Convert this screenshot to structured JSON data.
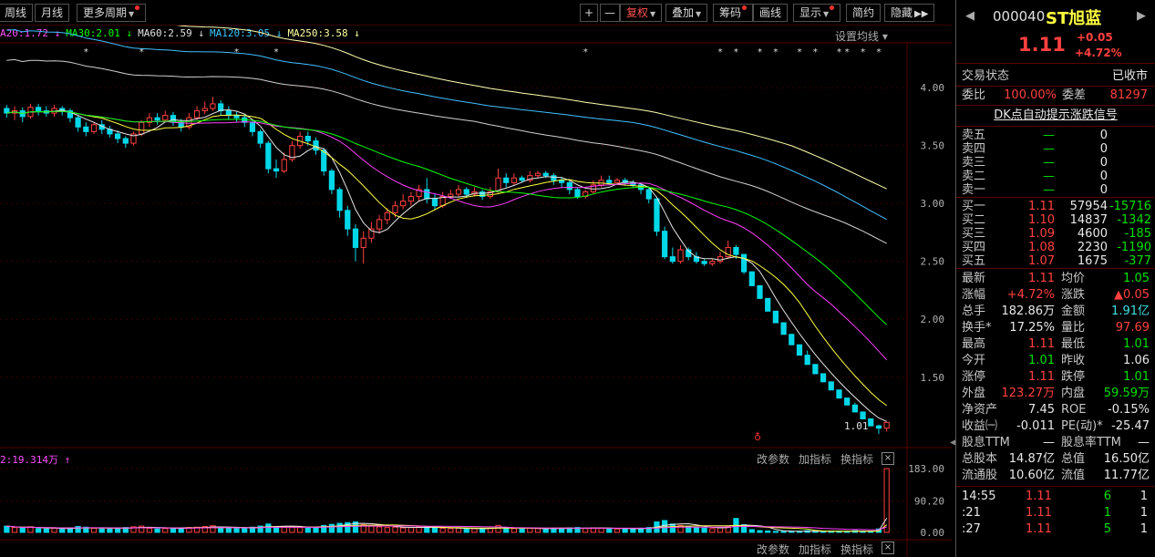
{
  "toolbar": {
    "weekly": "周线",
    "monthly": "月线",
    "more_periods": "更多周期",
    "plus": "+",
    "minus": "—",
    "adjust": "复权",
    "overlay": "叠加",
    "chips": "筹码",
    "draw": "画线",
    "display": "显示",
    "simple": "简约",
    "hide": "隐藏"
  },
  "ma_legend": [
    {
      "text": "A20:1.72",
      "color": "#ff50ff",
      "arrow": "↓"
    },
    {
      "text": "MA30:2.01",
      "color": "#00ff00",
      "arrow": "↓"
    },
    {
      "text": "MA60:2.59",
      "color": "#e0e0e0",
      "arrow": "↓"
    },
    {
      "text": "MA120:3.05",
      "color": "#40c8ff",
      "arrow": "↓"
    },
    {
      "text": "MA250:3.58",
      "color": "#ffffa0",
      "arrow": "↓"
    }
  ],
  "setting_ma": "设置均线 ▾",
  "volume_label": "2:19.314万 ↑",
  "low_marker": "1.01",
  "panel_buttons": {
    "change_param": "改参数",
    "add_indicator": "加指标",
    "switch_indicator": "换指标",
    "close": "×"
  },
  "chart_data": {
    "type": "candlestick",
    "y_ticks": [
      "4.00",
      "3.50",
      "3.00",
      "2.50",
      "2.00",
      "1.50"
    ],
    "y_range": [
      0.9,
      4.3
    ],
    "volume_ticks": [
      "183.00",
      "90.20",
      "0.00"
    ],
    "volume_range": [
      0,
      183
    ],
    "colors": {
      "up": "#ff4040",
      "down": "#00d8e8",
      "ma5": "#e8e8e8",
      "ma10": "#ffff40",
      "ma20": "#ff40ff",
      "ma30": "#00ff00",
      "ma60": "#d0d0d0",
      "ma120": "#40c0ff",
      "ma250": "#ffffb0"
    },
    "candles": [
      [
        3.82,
        3.78,
        3.85,
        3.74,
        18
      ],
      [
        3.78,
        3.8,
        3.84,
        3.72,
        14
      ],
      [
        3.8,
        3.75,
        3.83,
        3.7,
        12
      ],
      [
        3.75,
        3.83,
        3.86,
        3.73,
        16
      ],
      [
        3.83,
        3.8,
        3.86,
        3.76,
        11
      ],
      [
        3.8,
        3.78,
        3.84,
        3.75,
        10
      ],
      [
        3.78,
        3.82,
        3.85,
        3.75,
        12
      ],
      [
        3.82,
        3.8,
        3.84,
        3.76,
        9
      ],
      [
        3.8,
        3.74,
        3.82,
        3.7,
        13
      ],
      [
        3.74,
        3.66,
        3.76,
        3.62,
        17
      ],
      [
        3.66,
        3.62,
        3.7,
        3.58,
        15
      ],
      [
        3.62,
        3.68,
        3.7,
        3.6,
        12
      ],
      [
        3.68,
        3.64,
        3.72,
        3.6,
        10
      ],
      [
        3.64,
        3.6,
        3.67,
        3.57,
        11
      ],
      [
        3.6,
        3.56,
        3.63,
        3.52,
        13
      ],
      [
        3.56,
        3.52,
        3.58,
        3.48,
        14
      ],
      [
        3.52,
        3.6,
        3.62,
        3.5,
        16
      ],
      [
        3.6,
        3.7,
        3.72,
        3.58,
        18
      ],
      [
        3.7,
        3.74,
        3.78,
        3.66,
        12
      ],
      [
        3.74,
        3.72,
        3.78,
        3.68,
        10
      ],
      [
        3.72,
        3.76,
        3.8,
        3.7,
        11
      ],
      [
        3.76,
        3.7,
        3.79,
        3.67,
        12
      ],
      [
        3.7,
        3.66,
        3.73,
        3.62,
        13
      ],
      [
        3.66,
        3.74,
        3.78,
        3.64,
        14
      ],
      [
        3.74,
        3.8,
        3.84,
        3.72,
        15
      ],
      [
        3.8,
        3.82,
        3.88,
        3.77,
        17
      ],
      [
        3.82,
        3.86,
        3.92,
        3.8,
        19
      ],
      [
        3.86,
        3.8,
        3.89,
        3.76,
        14
      ],
      [
        3.8,
        3.76,
        3.84,
        3.72,
        12
      ],
      [
        3.76,
        3.74,
        3.79,
        3.7,
        11
      ],
      [
        3.74,
        3.7,
        3.77,
        3.66,
        12
      ],
      [
        3.7,
        3.62,
        3.72,
        3.58,
        15
      ],
      [
        3.62,
        3.52,
        3.64,
        3.48,
        18
      ],
      [
        3.52,
        3.3,
        3.54,
        3.26,
        24
      ],
      [
        3.3,
        3.28,
        3.38,
        3.22,
        16
      ],
      [
        3.28,
        3.38,
        3.44,
        3.26,
        15
      ],
      [
        3.38,
        3.5,
        3.54,
        3.36,
        17
      ],
      [
        3.5,
        3.58,
        3.62,
        3.47,
        14
      ],
      [
        3.58,
        3.54,
        3.62,
        3.5,
        12
      ],
      [
        3.54,
        3.46,
        3.57,
        3.42,
        14
      ],
      [
        3.46,
        3.28,
        3.48,
        3.24,
        20
      ],
      [
        3.28,
        3.12,
        3.3,
        3.08,
        23
      ],
      [
        3.12,
        2.94,
        3.14,
        2.88,
        26
      ],
      [
        2.94,
        2.78,
        2.98,
        2.72,
        28
      ],
      [
        2.78,
        2.62,
        2.82,
        2.5,
        30
      ],
      [
        2.62,
        2.7,
        2.76,
        2.48,
        22
      ],
      [
        2.7,
        2.78,
        2.84,
        2.66,
        18
      ],
      [
        2.78,
        2.86,
        2.9,
        2.74,
        16
      ],
      [
        2.86,
        2.92,
        2.96,
        2.82,
        14
      ],
      [
        2.92,
        2.98,
        3.02,
        2.88,
        15
      ],
      [
        2.98,
        3.02,
        3.08,
        2.95,
        13
      ],
      [
        3.02,
        3.06,
        3.1,
        2.98,
        14
      ],
      [
        3.06,
        3.12,
        3.16,
        3.02,
        16
      ],
      [
        3.12,
        3.04,
        3.22,
        3.0,
        15
      ],
      [
        3.04,
        2.98,
        3.08,
        2.95,
        13
      ],
      [
        2.98,
        3.06,
        3.1,
        2.96,
        12
      ],
      [
        3.06,
        3.08,
        3.12,
        3.04,
        11
      ],
      [
        3.08,
        3.12,
        3.16,
        3.06,
        12
      ],
      [
        3.12,
        3.08,
        3.14,
        3.05,
        10
      ],
      [
        3.08,
        3.1,
        3.14,
        3.06,
        11
      ],
      [
        3.1,
        3.06,
        3.12,
        3.03,
        10
      ],
      [
        3.06,
        3.1,
        3.14,
        3.04,
        12
      ],
      [
        3.1,
        3.22,
        3.3,
        3.09,
        20
      ],
      [
        3.22,
        3.18,
        3.26,
        3.14,
        13
      ],
      [
        3.18,
        3.22,
        3.26,
        3.16,
        11
      ],
      [
        3.22,
        3.2,
        3.24,
        3.18,
        10
      ],
      [
        3.2,
        3.24,
        3.28,
        3.18,
        12
      ],
      [
        3.24,
        3.26,
        3.28,
        3.22,
        11
      ],
      [
        3.26,
        3.24,
        3.28,
        3.22,
        10
      ],
      [
        3.24,
        3.2,
        3.26,
        3.16,
        12
      ],
      [
        3.2,
        3.18,
        3.23,
        3.14,
        11
      ],
      [
        3.18,
        3.12,
        3.2,
        3.08,
        13
      ],
      [
        3.12,
        3.06,
        3.14,
        3.04,
        14
      ],
      [
        3.06,
        3.1,
        3.12,
        3.04,
        12
      ],
      [
        3.1,
        3.16,
        3.2,
        3.08,
        13
      ],
      [
        3.16,
        3.2,
        3.24,
        3.14,
        12
      ],
      [
        3.2,
        3.18,
        3.24,
        3.16,
        11
      ],
      [
        3.18,
        3.2,
        3.22,
        3.16,
        10
      ],
      [
        3.2,
        3.18,
        3.22,
        3.16,
        10
      ],
      [
        3.18,
        3.16,
        3.2,
        3.14,
        11
      ],
      [
        3.16,
        3.12,
        3.18,
        3.08,
        12
      ],
      [
        3.12,
        3.04,
        3.14,
        3.0,
        14
      ],
      [
        3.04,
        2.76,
        3.06,
        2.72,
        30
      ],
      [
        2.76,
        2.54,
        2.8,
        2.52,
        34
      ],
      [
        2.54,
        2.5,
        2.62,
        2.48,
        24
      ],
      [
        2.5,
        2.6,
        2.64,
        2.48,
        20
      ],
      [
        2.6,
        2.54,
        2.62,
        2.51,
        16
      ],
      [
        2.54,
        2.5,
        2.58,
        2.48,
        14
      ],
      [
        2.5,
        2.48,
        2.52,
        2.46,
        12
      ],
      [
        2.48,
        2.5,
        2.52,
        2.46,
        11
      ],
      [
        2.5,
        2.54,
        2.58,
        2.48,
        13
      ],
      [
        2.54,
        2.62,
        2.68,
        2.52,
        18
      ],
      [
        2.62,
        2.56,
        2.64,
        2.52,
        40
      ],
      [
        2.56,
        2.41,
        2.56,
        2.39,
        22
      ],
      [
        2.41,
        2.29,
        2.41,
        2.29,
        8
      ],
      [
        2.29,
        2.18,
        2.29,
        2.18,
        5
      ],
      [
        2.18,
        2.07,
        2.18,
        2.07,
        4
      ],
      [
        2.07,
        1.97,
        2.07,
        1.97,
        3
      ],
      [
        1.97,
        1.87,
        1.97,
        1.87,
        3
      ],
      [
        1.87,
        1.78,
        1.87,
        1.78,
        3
      ],
      [
        1.78,
        1.69,
        1.78,
        1.69,
        3
      ],
      [
        1.69,
        1.61,
        1.73,
        1.61,
        5
      ],
      [
        1.61,
        1.53,
        1.61,
        1.53,
        3
      ],
      [
        1.53,
        1.46,
        1.53,
        1.46,
        3
      ],
      [
        1.46,
        1.39,
        1.46,
        1.39,
        3
      ],
      [
        1.39,
        1.32,
        1.39,
        1.32,
        3
      ],
      [
        1.32,
        1.26,
        1.32,
        1.26,
        3
      ],
      [
        1.26,
        1.2,
        1.28,
        1.2,
        5
      ],
      [
        1.2,
        1.14,
        1.2,
        1.14,
        3
      ],
      [
        1.14,
        1.08,
        1.14,
        1.08,
        3
      ],
      [
        1.08,
        1.06,
        1.09,
        1.01,
        10
      ],
      [
        1.06,
        1.11,
        1.11,
        1.03,
        183
      ]
    ]
  },
  "quote": {
    "code": "000040",
    "name": "ST旭蓝",
    "price": "1.11",
    "change": "+0.05",
    "change_pct": "+4.72%",
    "trade_status_label": "交易状态",
    "trade_status": "已收市",
    "weibi_label": "委比",
    "weibi": "100.00%",
    "weicha_label": "委差",
    "weicha": "81297",
    "dk_signal": "DK点自动提示涨跌信号",
    "asks": [
      {
        "label": "卖五",
        "price": "—",
        "vol": "0"
      },
      {
        "label": "卖四",
        "price": "—",
        "vol": "0"
      },
      {
        "label": "卖三",
        "price": "—",
        "vol": "0"
      },
      {
        "label": "卖二",
        "price": "—",
        "vol": "0"
      },
      {
        "label": "卖一",
        "price": "—",
        "vol": "0"
      }
    ],
    "bids": [
      {
        "label": "买一",
        "price": "1.11",
        "vol": "57954",
        "delta": "-15716"
      },
      {
        "label": "买二",
        "price": "1.10",
        "vol": "14837",
        "delta": "-1342"
      },
      {
        "label": "买三",
        "price": "1.09",
        "vol": "4600",
        "delta": "-185"
      },
      {
        "label": "买四",
        "price": "1.08",
        "vol": "2230",
        "delta": "-1190"
      },
      {
        "label": "买五",
        "price": "1.07",
        "vol": "1675",
        "delta": "-377"
      }
    ],
    "stats": [
      {
        "l1": "最新",
        "v1": "1.11",
        "c1": "red",
        "l2": "均价",
        "v2": "1.05",
        "c2": "green"
      },
      {
        "l1": "涨幅",
        "v1": "+4.72%",
        "c1": "red",
        "l2": "涨跌",
        "v2": "▲0.05",
        "c2": "red"
      },
      {
        "l1": "总手",
        "v1": "182.86万",
        "c1": "white",
        "l2": "金额",
        "v2": "1.91亿",
        "c2": "cyan"
      },
      {
        "l1": "换手*",
        "v1": "17.25%",
        "c1": "white",
        "l2": "量比",
        "v2": "97.69",
        "c2": "red"
      },
      {
        "l1": "最高",
        "v1": "1.11",
        "c1": "red",
        "l2": "最低",
        "v2": "1.01",
        "c2": "green"
      },
      {
        "l1": "今开",
        "v1": "1.01",
        "c1": "green",
        "l2": "昨收",
        "v2": "1.06",
        "c2": "white"
      },
      {
        "l1": "涨停",
        "v1": "1.11",
        "c1": "red",
        "l2": "跌停",
        "v2": "1.01",
        "c2": "green"
      },
      {
        "l1": "外盘",
        "v1": "123.27万",
        "c1": "red",
        "l2": "内盘",
        "v2": "59.59万",
        "c2": "green"
      },
      {
        "l1": "净资产",
        "v1": "7.45",
        "c1": "white",
        "l2": "ROE",
        "v2": "-0.15%",
        "c2": "white"
      },
      {
        "l1": "收益㈠",
        "v1": "-0.011",
        "c1": "white",
        "l2": "PE(动)*",
        "v2": "-25.47",
        "c2": "white"
      },
      {
        "l1": "股息TTM",
        "v1": "—",
        "c1": "white",
        "l2": "股息率TTM",
        "v2": "—",
        "c2": "white"
      },
      {
        "l1": "总股本",
        "v1": "14.87亿",
        "c1": "white",
        "l2": "总值",
        "v2": "16.50亿",
        "c2": "white"
      },
      {
        "l1": "流通股",
        "v1": "10.60亿",
        "c1": "white",
        "l2": "流值",
        "v2": "11.77亿",
        "c2": "white"
      }
    ],
    "ticks": [
      {
        "time": "14:55",
        "price": "1.11",
        "vol": "6",
        "n": "1"
      },
      {
        "time": ":21",
        "price": "1.11",
        "vol": "1",
        "n": "1"
      },
      {
        "time": ":27",
        "price": "1.11",
        "vol": "5",
        "n": "1"
      }
    ]
  }
}
